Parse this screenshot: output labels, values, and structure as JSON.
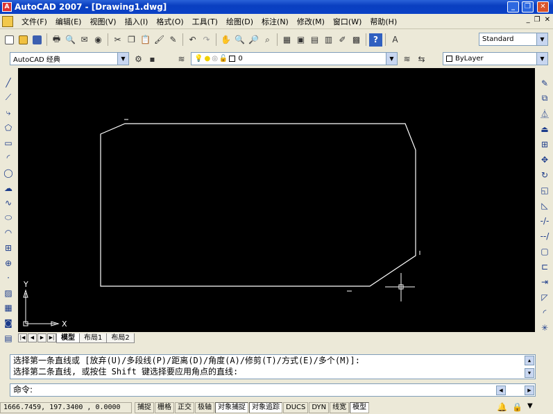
{
  "window": {
    "title": "AutoCAD 2007 - [Drawing1.dwg]"
  },
  "menu": [
    "文件(F)",
    "编辑(E)",
    "视图(V)",
    "插入(I)",
    "格式(O)",
    "工具(T)",
    "绘图(D)",
    "标注(N)",
    "修改(M)",
    "窗口(W)",
    "帮助(H)"
  ],
  "toolbar": {
    "text_style": "Standard",
    "workspace": "AutoCAD 经典",
    "layer": "0",
    "color": "ByLayer"
  },
  "layout_tabs": [
    "模型",
    "布局1",
    "布局2"
  ],
  "ucs": {
    "x_label": "X",
    "y_label": "Y"
  },
  "command": {
    "history_1": "选择第一条直线或 [放弃(U)/多段线(P)/距离(D)/角度(A)/修剪(T)/方式(E)/多个(M)]:",
    "history_2": "选择第二条直线, 或按住 Shift 键选择要应用角点的直线:",
    "prompt": "命令:"
  },
  "status": {
    "coordinates": "1666.7459, 197.3400 , 0.0000",
    "buttons": [
      "捕捉",
      "栅格",
      "正交",
      "极轴",
      "对象捕捉",
      "对象追踪",
      "DUCS",
      "DYN",
      "线宽",
      "模型"
    ]
  },
  "colors": {
    "canvas": "#000000",
    "geometry": "#ffffff",
    "titlebar": "#0a3fc0"
  }
}
